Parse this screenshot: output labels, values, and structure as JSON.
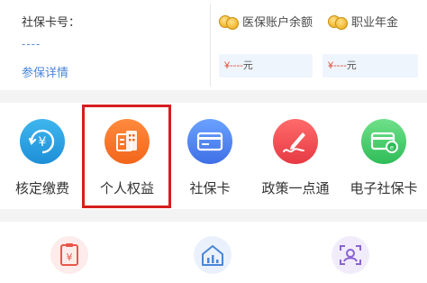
{
  "social_card": {
    "label": "社保卡号：",
    "value": "----",
    "detail_link": "参保详情"
  },
  "accounts": [
    {
      "title": "医保账户余额",
      "amount": "¥----",
      "unit": "元"
    },
    {
      "title": "职业年金",
      "amount": "¥----",
      "unit": "元"
    }
  ],
  "menu": [
    {
      "label": "核定缴费",
      "icon": "yuan-refresh-icon",
      "color": "#2ba3e6"
    },
    {
      "label": "个人权益",
      "icon": "building-card-icon",
      "color": "#f5731f"
    },
    {
      "label": "社保卡",
      "icon": "card-icon",
      "color": "#4f81f0"
    },
    {
      "label": "政策一点通",
      "icon": "pen-signature-icon",
      "color": "#ef4a4f"
    },
    {
      "label": "电子社保卡",
      "icon": "e-card-icon",
      "color": "#3fca66"
    }
  ],
  "bottom_icons": [
    {
      "icon": "clipboard-yuan-icon",
      "color": "#e8574a"
    },
    {
      "icon": "house-chart-icon",
      "color": "#4a86d8"
    },
    {
      "icon": "face-scan-icon",
      "color": "#8a63d2"
    }
  ],
  "highlight_color": "#d71e1e"
}
